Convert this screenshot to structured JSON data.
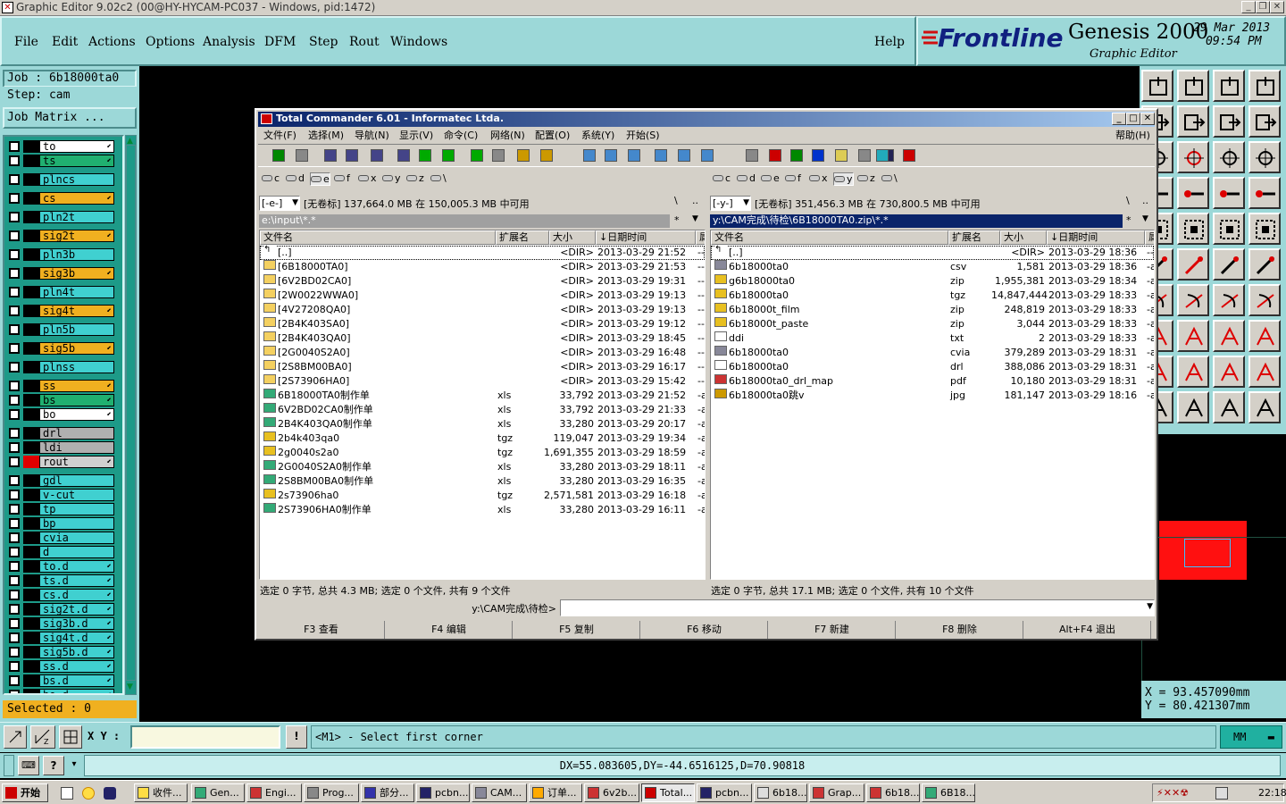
{
  "window": {
    "title": "Graphic Editor 9.02c2 (00@HY-HYCAM-PC037 - Windows, pid:1472)"
  },
  "menu": [
    "File",
    "Edit",
    "Actions",
    "Options",
    "Analysis",
    "DFM",
    "Step",
    "Rout",
    "Windows"
  ],
  "help": "Help",
  "brand": {
    "logo": "Frontline",
    "product": "Genesis 2000",
    "subtitle": "Graphic Editor",
    "date": "29 Mar 2013",
    "time": "09:54 PM"
  },
  "job": {
    "job_line": "Job : 6b18000ta0",
    "step_line": "Step: cam",
    "matrix": "Job Matrix ..."
  },
  "layers": [
    {
      "name": "to",
      "bg": "#ffffff",
      "sw": "#000000",
      "arrow": true
    },
    {
      "name": "ts",
      "bg": "#20b070",
      "sw": "#000000",
      "arrow": true
    },
    {
      "name": "plncs",
      "bg": "#40d0d0",
      "sw": "#000000",
      "arrow": false
    },
    {
      "name": "cs",
      "bg": "#f0b020",
      "sw": "#000000",
      "arrow": true
    },
    {
      "name": "pln2t",
      "bg": "#40d0d0",
      "sw": "#000000",
      "arrow": false
    },
    {
      "name": "sig2t",
      "bg": "#f0b020",
      "sw": "#000000",
      "arrow": true
    },
    {
      "name": "pln3b",
      "bg": "#40d0d0",
      "sw": "#000000",
      "arrow": false
    },
    {
      "name": "sig3b",
      "bg": "#f0b020",
      "sw": "#000000",
      "arrow": true
    },
    {
      "name": "pln4t",
      "bg": "#40d0d0",
      "sw": "#000000",
      "arrow": false
    },
    {
      "name": "sig4t",
      "bg": "#f0b020",
      "sw": "#000000",
      "arrow": true
    },
    {
      "name": "pln5b",
      "bg": "#40d0d0",
      "sw": "#000000",
      "arrow": false
    },
    {
      "name": "sig5b",
      "bg": "#f0b020",
      "sw": "#000000",
      "arrow": true
    },
    {
      "name": "plnss",
      "bg": "#40d0d0",
      "sw": "#000000",
      "arrow": false
    },
    {
      "name": "ss",
      "bg": "#f0b020",
      "sw": "#000000",
      "arrow": true
    },
    {
      "name": "bs",
      "bg": "#20b070",
      "sw": "#000000",
      "arrow": true
    },
    {
      "name": "bo",
      "bg": "#ffffff",
      "sw": "#000000",
      "arrow": true
    },
    {
      "name": "drl",
      "bg": "#b0b0b0",
      "sw": "#000000",
      "arrow": false
    },
    {
      "name": "ldi",
      "bg": "#b0b0b0",
      "sw": "#000000",
      "arrow": false
    },
    {
      "name": "rout",
      "bg": "#d0d0d0",
      "sw": "#e00000",
      "arrow": true
    },
    {
      "name": "gdl",
      "bg": "#40d0d0",
      "sw": "#000000",
      "arrow": false
    },
    {
      "name": "v-cut",
      "bg": "#40d0d0",
      "sw": "#000000",
      "arrow": false
    },
    {
      "name": "tp",
      "bg": "#40d0d0",
      "sw": "#000000",
      "arrow": false
    },
    {
      "name": "bp",
      "bg": "#40d0d0",
      "sw": "#000000",
      "arrow": false
    },
    {
      "name": "cvia",
      "bg": "#40d0d0",
      "sw": "#000000",
      "arrow": false
    },
    {
      "name": "d",
      "bg": "#40d0d0",
      "sw": "#000000",
      "arrow": false
    },
    {
      "name": "to.d",
      "bg": "#40d0d0",
      "sw": "#000000",
      "arrow": true
    },
    {
      "name": "ts.d",
      "bg": "#40d0d0",
      "sw": "#000000",
      "arrow": true
    },
    {
      "name": "cs.d",
      "bg": "#40d0d0",
      "sw": "#000000",
      "arrow": true
    },
    {
      "name": "sig2t.d",
      "bg": "#40d0d0",
      "sw": "#000000",
      "arrow": true
    },
    {
      "name": "sig3b.d",
      "bg": "#40d0d0",
      "sw": "#000000",
      "arrow": true
    },
    {
      "name": "sig4t.d",
      "bg": "#40d0d0",
      "sw": "#000000",
      "arrow": true
    },
    {
      "name": "sig5b.d",
      "bg": "#40d0d0",
      "sw": "#000000",
      "arrow": true
    },
    {
      "name": "ss.d",
      "bg": "#40d0d0",
      "sw": "#000000",
      "arrow": true
    },
    {
      "name": "bs.d",
      "bg": "#40d0d0",
      "sw": "#000000",
      "arrow": true
    },
    {
      "name": "bo.d",
      "bg": "#40d0d0",
      "sw": "#000000",
      "arrow": true
    }
  ],
  "selected": "Selected : 0",
  "coords": {
    "x": "X = 93.457090mm",
    "y": "Y = 80.421307mm"
  },
  "cmd": {
    "xy_label": "X Y :",
    "prompt": "<M1> - Select first corner",
    "units": "MM"
  },
  "status_line": "DX=55.083605,DY=-44.6516125,D=70.90818",
  "tc": {
    "title": "Total Commander 6.01 - Informatec Ltda.",
    "menu": [
      "文件(F)",
      "选择(M)",
      "导航(N)",
      "显示(V)",
      "命令(C)",
      "网络(N)",
      "配置(O)",
      "系统(Y)",
      "开始(S)"
    ],
    "help": "帮助(H)",
    "drives": [
      "c",
      "d",
      "e",
      "f",
      "x",
      "y",
      "z",
      "\\"
    ],
    "left": {
      "drive_select": "[-e-]",
      "free": "[无卷标]  137,664.0 MB 在 150,005.3 MB 中可用",
      "path": "e:\\input\\*.*",
      "headers": [
        "文件名",
        "扩展名",
        "大小",
        "↓日期时间",
        "属"
      ],
      "files": [
        {
          "icon": "up",
          "name": "[..]",
          "ext": "",
          "size": "<DIR>",
          "date": "2013-03-29 21:52",
          "attr": "----"
        },
        {
          "icon": "folder",
          "name": "[6B18000TA0]",
          "ext": "",
          "size": "<DIR>",
          "date": "2013-03-29 21:53",
          "attr": "----"
        },
        {
          "icon": "folder",
          "name": "[6V2BD02CA0]",
          "ext": "",
          "size": "<DIR>",
          "date": "2013-03-29 19:31",
          "attr": "----"
        },
        {
          "icon": "folder",
          "name": "[2W0022WWA0]",
          "ext": "",
          "size": "<DIR>",
          "date": "2013-03-29 19:13",
          "attr": "----"
        },
        {
          "icon": "folder",
          "name": "[4V27208QA0]",
          "ext": "",
          "size": "<DIR>",
          "date": "2013-03-29 19:13",
          "attr": "----"
        },
        {
          "icon": "folder",
          "name": "[2B4K403SA0]",
          "ext": "",
          "size": "<DIR>",
          "date": "2013-03-29 19:12",
          "attr": "----"
        },
        {
          "icon": "folder",
          "name": "[2B4K403QA0]",
          "ext": "",
          "size": "<DIR>",
          "date": "2013-03-29 18:45",
          "attr": "----"
        },
        {
          "icon": "folder",
          "name": "[2G0040S2A0]",
          "ext": "",
          "size": "<DIR>",
          "date": "2013-03-29 16:48",
          "attr": "----"
        },
        {
          "icon": "folder",
          "name": "[2S8BM00BA0]",
          "ext": "",
          "size": "<DIR>",
          "date": "2013-03-29 16:17",
          "attr": "----"
        },
        {
          "icon": "folder",
          "name": "[2S73906HA0]",
          "ext": "",
          "size": "<DIR>",
          "date": "2013-03-29 15:42",
          "attr": "----"
        },
        {
          "icon": "xls",
          "name": "6B18000TA0制作单",
          "ext": "xls",
          "size": "33,792",
          "date": "2013-03-29 21:52",
          "attr": "-a-"
        },
        {
          "icon": "xls",
          "name": "6V2BD02CA0制作单",
          "ext": "xls",
          "size": "33,792",
          "date": "2013-03-29 21:33",
          "attr": "-a-"
        },
        {
          "icon": "xls",
          "name": "2B4K403QA0制作单",
          "ext": "xls",
          "size": "33,280",
          "date": "2013-03-29 20:17",
          "attr": "-a-"
        },
        {
          "icon": "arc",
          "name": "2b4k403qa0",
          "ext": "tgz",
          "size": "119,047",
          "date": "2013-03-29 19:34",
          "attr": "-a-"
        },
        {
          "icon": "arc",
          "name": "2g0040s2a0",
          "ext": "tgz",
          "size": "1,691,355",
          "date": "2013-03-29 18:59",
          "attr": "-a-"
        },
        {
          "icon": "xls",
          "name": "2G0040S2A0制作单",
          "ext": "xls",
          "size": "33,280",
          "date": "2013-03-29 18:11",
          "attr": "-a-"
        },
        {
          "icon": "xls",
          "name": "2S8BM00BA0制作单",
          "ext": "xls",
          "size": "33,280",
          "date": "2013-03-29 16:35",
          "attr": "-a-"
        },
        {
          "icon": "arc",
          "name": "2s73906ha0",
          "ext": "tgz",
          "size": "2,571,581",
          "date": "2013-03-29 16:18",
          "attr": "-a-"
        },
        {
          "icon": "xls",
          "name": "2S73906HA0制作单",
          "ext": "xls",
          "size": "33,280",
          "date": "2013-03-29 16:11",
          "attr": "-a-"
        }
      ],
      "status": "选定 0 字节, 总共 4.3 MB; 选定 0 个文件, 共有 9 个文件"
    },
    "right": {
      "drive_select": "[-y-]",
      "free": "[无卷标]  351,456.3 MB 在 730,800.5 MB 中可用",
      "path": "y:\\CAM完成\\待检\\6B18000TA0.zip\\*.*",
      "headers": [
        "文件名",
        "扩展名",
        "大小",
        "↓日期时间",
        "属"
      ],
      "files": [
        {
          "icon": "up",
          "name": "[..]",
          "ext": "",
          "size": "<DIR>",
          "date": "2013-03-29 18:36",
          "attr": "----"
        },
        {
          "icon": "doc",
          "name": "6b18000ta0",
          "ext": "csv",
          "size": "1,581",
          "date": "2013-03-29 18:36",
          "attr": "-a-"
        },
        {
          "icon": "arc",
          "name": "g6b18000ta0",
          "ext": "zip",
          "size": "1,955,381",
          "date": "2013-03-29 18:34",
          "attr": "-a-"
        },
        {
          "icon": "arc",
          "name": "6b18000ta0",
          "ext": "tgz",
          "size": "14,847,444",
          "date": "2013-03-29 18:33",
          "attr": "-a-"
        },
        {
          "icon": "arc",
          "name": "6b18000t_film",
          "ext": "zip",
          "size": "248,819",
          "date": "2013-03-29 18:33",
          "attr": "-a-"
        },
        {
          "icon": "arc",
          "name": "6b18000t_paste",
          "ext": "zip",
          "size": "3,044",
          "date": "2013-03-29 18:33",
          "attr": "-a-"
        },
        {
          "icon": "txt",
          "name": "ddi",
          "ext": "txt",
          "size": "2",
          "date": "2013-03-29 18:33",
          "attr": "-a-"
        },
        {
          "icon": "doc",
          "name": "6b18000ta0",
          "ext": "cvia",
          "size": "379,289",
          "date": "2013-03-29 18:31",
          "attr": "-a-"
        },
        {
          "icon": "blank",
          "name": "6b18000ta0",
          "ext": "drl",
          "size": "388,086",
          "date": "2013-03-29 18:31",
          "attr": "-a-"
        },
        {
          "icon": "pdf",
          "name": "6b18000ta0_drl_map",
          "ext": "pdf",
          "size": "10,180",
          "date": "2013-03-29 18:31",
          "attr": "-a-"
        },
        {
          "icon": "img",
          "name": "6b18000ta0跳v",
          "ext": "jpg",
          "size": "181,147",
          "date": "2013-03-29 18:16",
          "attr": "-a-"
        }
      ],
      "status": "选定 0 字节, 总共 17.1 MB; 选定 0 个文件, 共有 10 个文件"
    },
    "cmdline_path": "y:\\CAM完成\\待检>",
    "fkeys": [
      "F3 查看",
      "F4 编辑",
      "F5 复制",
      "F6 移动",
      "F7 新建",
      "F8 删除",
      "Alt+F4 退出"
    ]
  },
  "taskbar": {
    "start": "开始",
    "tasks": [
      "收件...",
      "Gen...",
      "Engi...",
      "Prog...",
      "部分...",
      "pcbn...",
      "CAM...",
      "订单...",
      "6v2b...",
      "Total...",
      "pcbn...",
      "6b18...",
      "Grap...",
      "6b18...",
      "6B18..."
    ],
    "clock": "22:18"
  },
  "colors": {
    "teal": "#9cd8d8",
    "layerbg": "#1d9a88",
    "selection": "#0a246a",
    "accent_red": "#e00000"
  }
}
